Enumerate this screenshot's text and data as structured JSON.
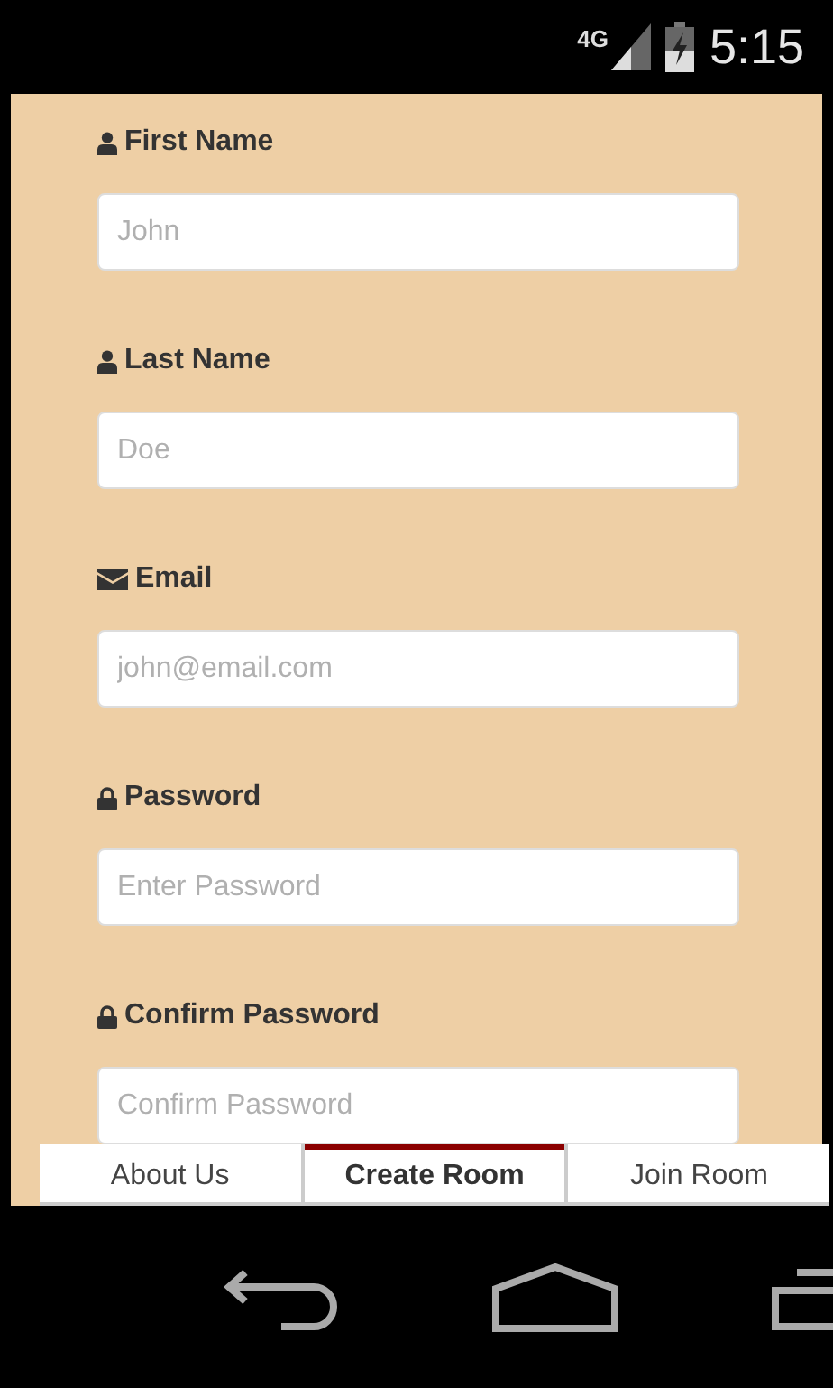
{
  "status_bar": {
    "network": "4G",
    "time": "5:15"
  },
  "fields": [
    {
      "kind": "user",
      "label": "First Name",
      "placeholder": "John"
    },
    {
      "kind": "user",
      "label": "Last Name",
      "placeholder": "Doe"
    },
    {
      "kind": "email",
      "label": "Email",
      "placeholder": "john@email.com"
    },
    {
      "kind": "lock",
      "label": "Password",
      "placeholder": "Enter Password"
    },
    {
      "kind": "lock",
      "label": "Confirm Password",
      "placeholder": "Confirm Password"
    }
  ],
  "tabs": [
    {
      "label": "About Us",
      "selected": false
    },
    {
      "label": "Create Room",
      "selected": true
    },
    {
      "label": "Join Room",
      "selected": false
    }
  ]
}
